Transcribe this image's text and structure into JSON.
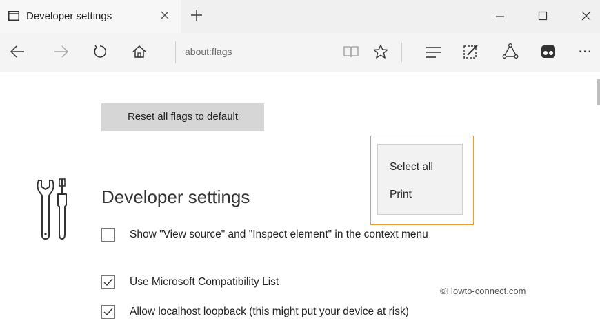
{
  "tab": {
    "title": "Developer settings",
    "close_symbol": "×",
    "new_tab_symbol": "+"
  },
  "window_controls": {
    "minimize_symbol": "–",
    "maximize_symbol": "☐",
    "close_symbol": "×"
  },
  "address_bar": {
    "url": "about:flags"
  },
  "toolbar_icons": {
    "back": "arrow-left-icon",
    "forward": "arrow-right-icon",
    "refresh": "refresh-icon",
    "home": "home-icon",
    "reading_view": "book-icon",
    "favorite": "star-icon",
    "hub": "hub-icon",
    "web_note": "pen-note-icon",
    "share": "share-icon",
    "extension": "extension-icon",
    "more": "⋯"
  },
  "content": {
    "reset_button_label": "Reset all flags to default",
    "section_title": "Developer settings",
    "options": [
      {
        "label": "Show \"View source\" and \"Inspect element\" in the context menu",
        "checked": false
      },
      {
        "label": "Use Microsoft Compatibility List",
        "checked": true
      },
      {
        "label": "Allow localhost loopback (this might put your device at risk)",
        "checked": true
      }
    ]
  },
  "context_menu": {
    "items": [
      "Select all",
      "Print"
    ],
    "highlight_color": "#f29a3e"
  },
  "watermark": "©Howto-connect.com"
}
